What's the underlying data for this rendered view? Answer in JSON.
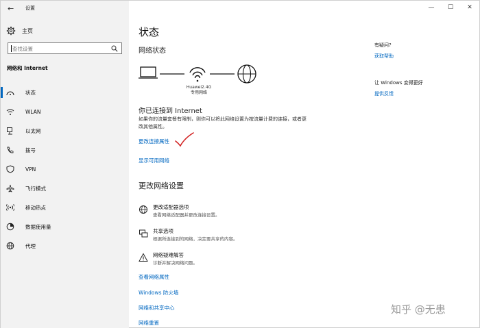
{
  "window": {
    "app_title": "设置",
    "back_glyph": "←",
    "controls": {
      "minimize": "—",
      "maximize": "☐",
      "close": "✕"
    }
  },
  "sidebar": {
    "home_label": "主页",
    "search_placeholder": "查找设置",
    "section_title": "网络和 Internet",
    "items": [
      {
        "label": "状态",
        "icon": "home-status-icon",
        "active": true
      },
      {
        "label": "WLAN",
        "icon": "wifi-icon"
      },
      {
        "label": "以太网",
        "icon": "ethernet-icon"
      },
      {
        "label": "拨号",
        "icon": "phone-icon"
      },
      {
        "label": "VPN",
        "icon": "vpn-icon"
      },
      {
        "label": "飞行模式",
        "icon": "airplane-icon"
      },
      {
        "label": "移动热点",
        "icon": "hotspot-icon"
      },
      {
        "label": "数据使用量",
        "icon": "data-usage-icon"
      },
      {
        "label": "代理",
        "icon": "globe-icon"
      }
    ]
  },
  "main": {
    "page_title": "状态",
    "network_status": "网络状态",
    "network_name": "Huawei2.4G",
    "network_type": "专用网络",
    "connected_title": "你已连接到 Internet",
    "connected_desc": "如果你的流量套餐有限制，则你可以将此网络设置为按流量计费的连接，或者更改其他属性。",
    "change_properties": "更改连接属性",
    "show_networks": "显示可用网络",
    "settings_title": "更改网络设置",
    "options": [
      {
        "title": "更改适配器选项",
        "desc": "查看网络适配器并更改连接设置。",
        "icon": "adapter-icon"
      },
      {
        "title": "共享选项",
        "desc": "根据所连接到的网络，决定要共享的内容。",
        "icon": "sharing-icon"
      },
      {
        "title": "网络疑难解答",
        "desc": "诊断并解决网络问题。",
        "icon": "warning-icon"
      }
    ],
    "links": [
      "查看网络属性",
      "Windows 防火墙",
      "网络和共享中心",
      "网络重置"
    ]
  },
  "aside": {
    "question1": "有疑问?",
    "answer1": "获取帮助",
    "question2": "让 Windows 变得更好",
    "answer2": "提供反馈"
  },
  "watermark": "知乎 @无患"
}
